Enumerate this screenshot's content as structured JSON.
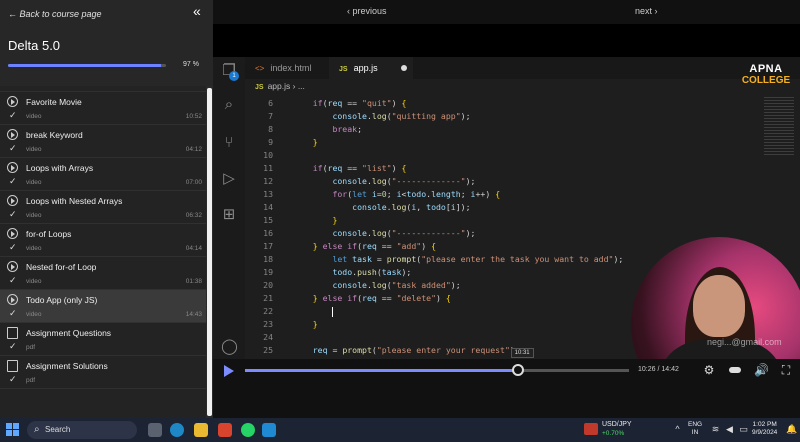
{
  "sidebar": {
    "back_label": "← Back to course page",
    "course_title": "Delta 5.0",
    "progress_percent": 97,
    "progress_label": "97 %",
    "lessons": [
      {
        "name": "",
        "type": "video",
        "duration": "04:08",
        "kind": "video",
        "active": false,
        "partial": true
      },
      {
        "name": "Favorite Movie",
        "type": "video",
        "duration": "10:52",
        "kind": "video",
        "active": false
      },
      {
        "name": "break Keyword",
        "type": "video",
        "duration": "04:12",
        "kind": "video",
        "active": false
      },
      {
        "name": "Loops with Arrays",
        "type": "video",
        "duration": "07:00",
        "kind": "video",
        "active": false
      },
      {
        "name": "Loops with Nested Arrays",
        "type": "video",
        "duration": "06:32",
        "kind": "video",
        "active": false
      },
      {
        "name": "for-of Loops",
        "type": "video",
        "duration": "04:14",
        "kind": "video",
        "active": false
      },
      {
        "name": "Nested for-of Loop",
        "type": "video",
        "duration": "01:38",
        "kind": "video",
        "active": false
      },
      {
        "name": "Todo App (only JS)",
        "type": "video",
        "duration": "14:43",
        "kind": "video",
        "active": true
      },
      {
        "name": "Assignment Questions",
        "type": "pdf",
        "duration": "",
        "kind": "doc",
        "active": false
      },
      {
        "name": "Assignment Solutions",
        "type": "pdf",
        "duration": "",
        "kind": "doc",
        "active": false
      }
    ]
  },
  "topbar": {
    "prev_label": "‹ previous",
    "next_label": "next ›"
  },
  "editor": {
    "explorer_badge": "1",
    "tabs": [
      {
        "label": "index.html",
        "icon": "html-icon",
        "active": false
      },
      {
        "label": "app.js",
        "icon": "js-icon",
        "active": true
      }
    ],
    "breadcrumb_icon": "JS",
    "breadcrumb_file": "app.js",
    "breadcrumb_sep": "› ...",
    "code_lines": [
      {
        "n": "6",
        "html": "    <span class='kw'>if</span>(<span class='var'>req</span> == <span class='str'>\"quit\"</span>) <span class='br'>{</span>"
      },
      {
        "n": "7",
        "html": "        <span class='var'>console</span>.<span class='fn'>log</span>(<span class='str'>\"quitting app\"</span>);"
      },
      {
        "n": "8",
        "html": "        <span class='kw'>break</span>;"
      },
      {
        "n": "9",
        "html": "    <span class='br'>}</span>"
      },
      {
        "n": "10",
        "html": ""
      },
      {
        "n": "11",
        "html": "    <span class='kw'>if</span>(<span class='var'>req</span> == <span class='str'>\"list\"</span>) <span class='br'>{</span>"
      },
      {
        "n": "12",
        "html": "        <span class='var'>console</span>.<span class='fn'>log</span>(<span class='str'>\"-------------\"</span>);"
      },
      {
        "n": "13",
        "html": "        <span class='kw'>for</span>(<span class='kb'>let</span> <span class='var'>i</span>=<span class='num'>0</span>; <span class='var'>i</span>&lt;<span class='var'>todo</span>.<span class='var'>length</span>; <span class='var'>i</span>++) <span class='br'>{</span>"
      },
      {
        "n": "14",
        "html": "            <span class='var'>console</span>.<span class='fn'>log</span>(<span class='var'>i</span>, <span class='var'>todo</span>[<span class='var'>i</span>]);"
      },
      {
        "n": "15",
        "html": "        <span class='br'>}</span>"
      },
      {
        "n": "16",
        "html": "        <span class='var'>console</span>.<span class='fn'>log</span>(<span class='str'>\"-------------\"</span>);"
      },
      {
        "n": "17",
        "html": "    <span class='br'>}</span> <span class='kw'>else if</span>(<span class='var'>req</span> == <span class='str'>\"add\"</span>) <span class='br'>{</span>"
      },
      {
        "n": "18",
        "html": "        <span class='kb'>let</span> <span class='var'>task</span> = <span class='fn'>prompt</span>(<span class='str'>\"please enter the task you want to add\"</span>);"
      },
      {
        "n": "19",
        "html": "        <span class='var'>todo</span>.<span class='fn'>push</span>(<span class='var'>task</span>);"
      },
      {
        "n": "20",
        "html": "        <span class='var'>console</span>.<span class='fn'>log</span>(<span class='str'>\"task added\"</span>);"
      },
      {
        "n": "21",
        "html": "    <span class='br'>}</span> <span class='kw'>else if</span>(<span class='var'>req</span> == <span class='str'>\"delete\"</span>) <span class='br'>{</span>"
      },
      {
        "n": "22",
        "html": "        <span class='cursor'></span>"
      },
      {
        "n": "23",
        "html": "    <span class='br'>}</span>"
      },
      {
        "n": "24",
        "html": ""
      },
      {
        "n": "25",
        "html": "    <span class='var'>req</span> = <span class='fn'>prompt</span>(<span class='str'>\"please enter your request\"</span>);"
      }
    ]
  },
  "overlay": {
    "logo_line1": "APNA",
    "logo_line2": "COLLEGE",
    "watermark": "negi...@gmail.com"
  },
  "player": {
    "played_fraction": 0.71,
    "hover_time": "10:31",
    "timecode": "10:26 / 14:42",
    "accent_color": "#7c8cff"
  },
  "taskbar": {
    "search_label": "Search",
    "ticker_pair": "USD/JPY",
    "ticker_change": "+0.70%",
    "lang_line1": "ENG",
    "lang_line2": "IN",
    "time": "1:02 PM",
    "date": "9/9/2024"
  }
}
